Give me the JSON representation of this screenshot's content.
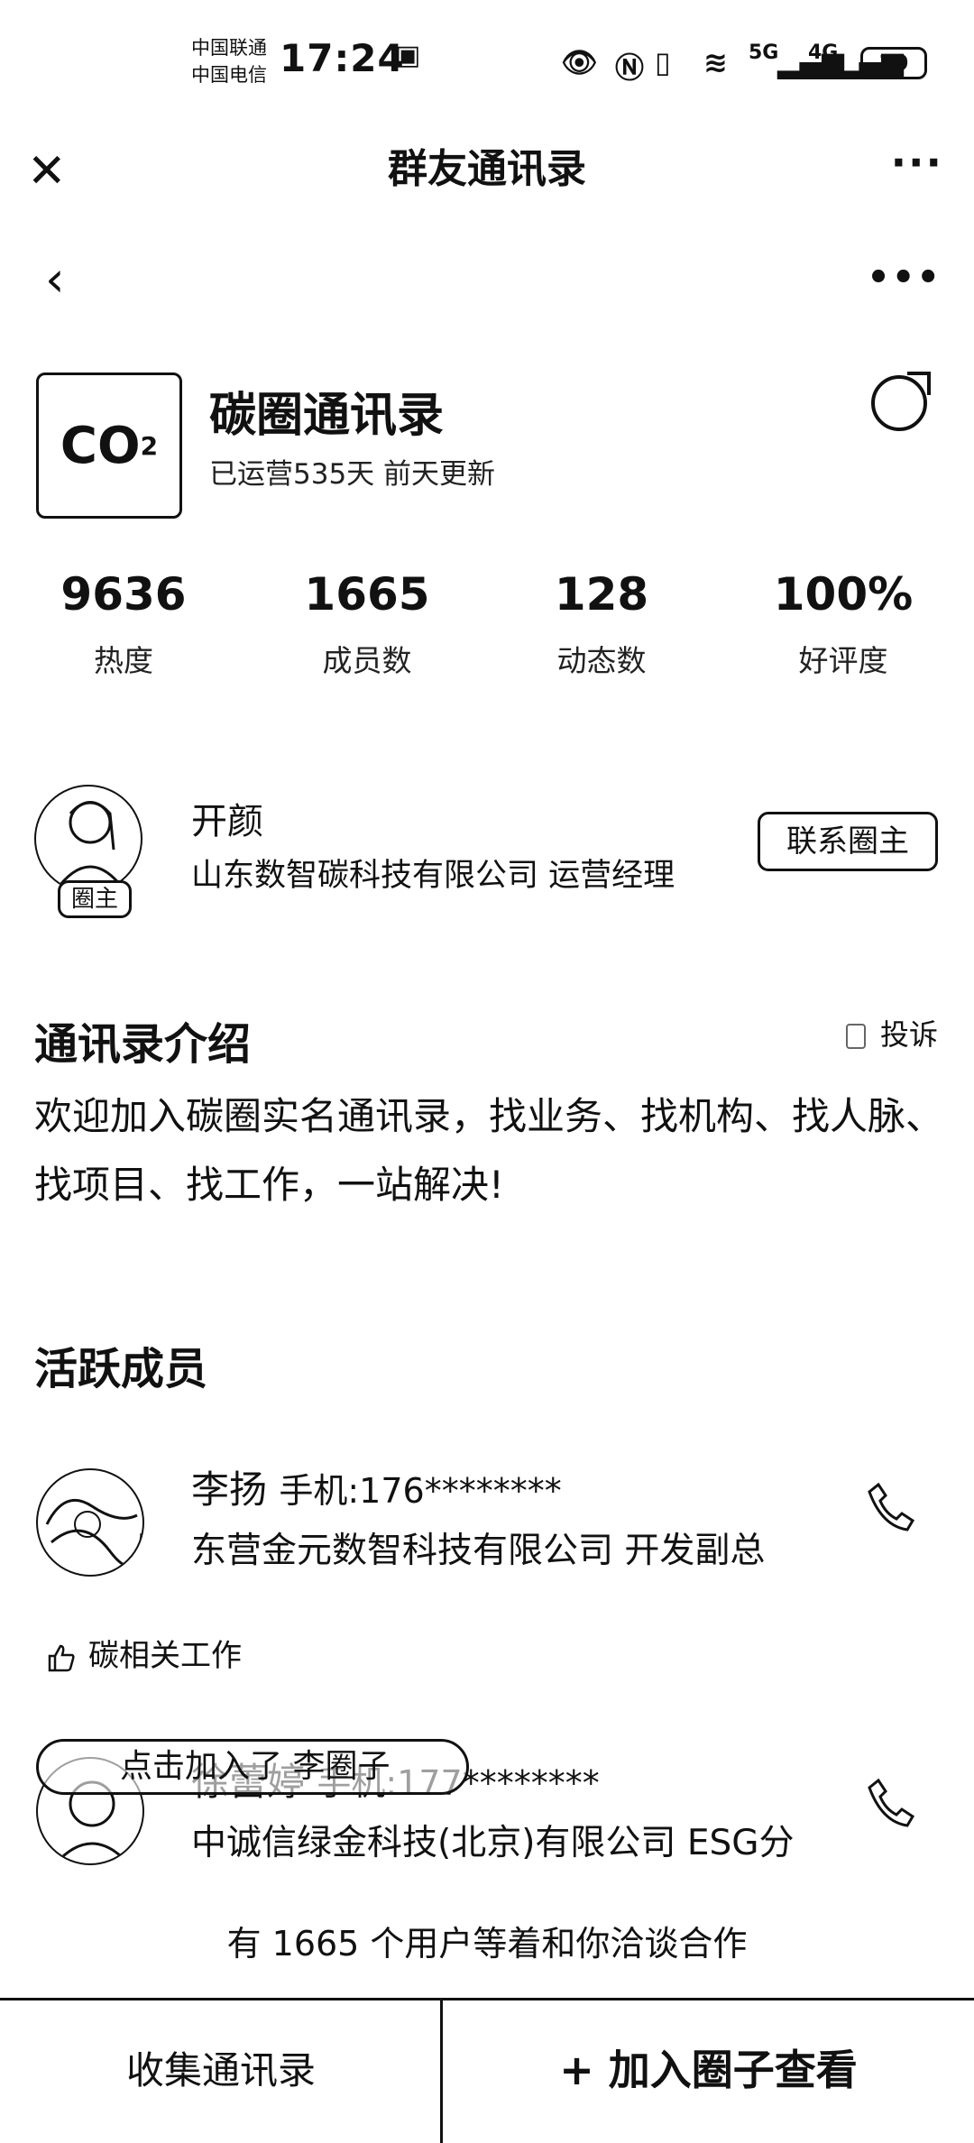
{
  "status_bar": {
    "carrier1": "中国联通",
    "carrier2": "中国电信",
    "time": "17:24",
    "signal1": "5G",
    "signal2": "4G",
    "battery": "39"
  },
  "nav": {
    "title": "群友通讯录"
  },
  "group": {
    "logo_text": "CO",
    "logo_sub": "2",
    "name": "碳圈通讯录",
    "subtitle": "已运营535天  前天更新"
  },
  "stats": [
    {
      "value": "9636",
      "label": "热度"
    },
    {
      "value": "1665",
      "label": "成员数"
    },
    {
      "value": "128",
      "label": "动态数"
    },
    {
      "value": "100%",
      "label": "好评度"
    }
  ],
  "owner": {
    "badge": "圈主",
    "name": "开颜",
    "company": "山东数智碳科技有限公司 运营经理",
    "contact_button": "联系圈主"
  },
  "intro": {
    "title": "通讯录介绍",
    "complaint": "投诉",
    "text": "欢迎加入碳圈实名通讯录，找业务、找机构、找人脉、找项目、找工作，一站解决!"
  },
  "members": {
    "title": "活跃成员",
    "items": [
      {
        "name": "李扬",
        "phone": "手机:176********",
        "company": "东营金元数智科技有限公司 开发副总",
        "tag": "碳相关工作"
      },
      {
        "name": "徐蕾婷",
        "phone": "手机:177********",
        "company": "中诚信绿金科技(北京)有限公司 ESG分"
      }
    ]
  },
  "floating_banner": "点击加入了 李圈子",
  "waiting_text": "有 1665 个用户等着和你洽谈合作",
  "bottom_bar": {
    "collect": "收集通讯录",
    "join": "+ 加入圈子查看"
  }
}
